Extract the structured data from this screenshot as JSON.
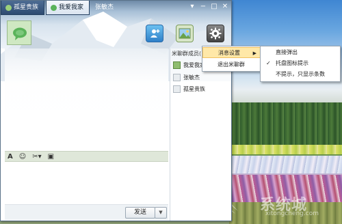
{
  "window": {
    "tabs": [
      {
        "label": "孤星贵族"
      },
      {
        "label": "我爱我家"
      },
      {
        "label": "张敏杰"
      }
    ],
    "controls": {
      "menu": "▾",
      "minimize": "−",
      "maximize": "□",
      "close": "✕"
    }
  },
  "toolbar": {
    "members_icon": "group-members-icon",
    "photo_icon": "photo-icon",
    "settings_icon": "gear-icon"
  },
  "format_bar": {
    "font": "A",
    "emoji": "☺",
    "scissors": "✂▾",
    "screenshot": "▣"
  },
  "footer": {
    "send_label": "发送",
    "send_dropdown": "▼"
  },
  "members": {
    "title": "米聊群成员(",
    "items": [
      {
        "name": "我爱我家",
        "online": true
      },
      {
        "name": "张敏杰",
        "online": false
      },
      {
        "name": "孤星贵族",
        "online": false
      }
    ]
  },
  "context_menu": {
    "items": [
      {
        "label": "消息设置",
        "arrow": "▶"
      },
      {
        "label": "退出米聊群"
      }
    ]
  },
  "submenu": {
    "items": [
      {
        "label": "直接弹出",
        "checked": false
      },
      {
        "label": "托盘图标提示",
        "checked": true,
        "check_mark": "✓"
      },
      {
        "label": "不提示，只显示条数",
        "checked": false
      }
    ]
  },
  "watermark": {
    "text": "系统城",
    "sub": "xitongcheng.com"
  }
}
